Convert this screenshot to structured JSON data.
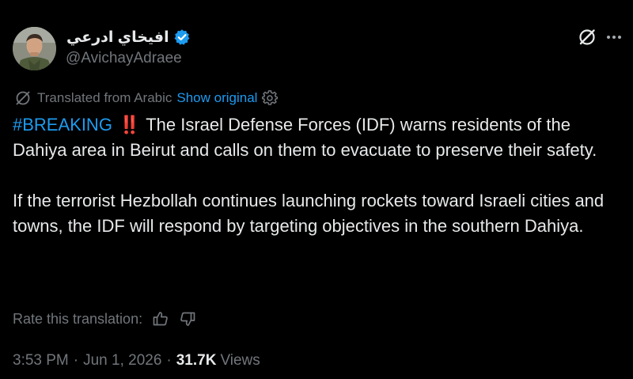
{
  "author": {
    "display_name": "افيخاي ادرعي",
    "handle": "@AvichayAdraee",
    "verified": true,
    "verified_color": "#1d9bf0",
    "avatar_icon": "avatar-soldier-portrait"
  },
  "header_actions": {
    "grok_icon": "grok-slash-icon",
    "more_icon": "more-horizontal-icon"
  },
  "translation": {
    "label": "Translated from Arabic",
    "show_original": "Show original",
    "icon": "translate-slash-icon",
    "settings_icon": "gear-icon"
  },
  "tweet": {
    "hashtag": "#BREAKING",
    "alert_emoji": "‼️",
    "paragraph1": "The Israel Defense Forces (IDF) warns residents of the Dahiya area in Beirut and calls on them to evacuate to preserve their safety.",
    "paragraph2": "If the terrorist Hezbollah continues launching rockets toward Israeli cities and towns, the IDF will respond by targeting objectives in the southern Dahiya."
  },
  "rate": {
    "label": "Rate this translation:",
    "up_icon": "thumbs-up-icon",
    "down_icon": "thumbs-down-icon"
  },
  "meta": {
    "time": "3:53 PM",
    "separator": "·",
    "date": "Jun 1, 2026",
    "views_count": "31.7K",
    "views_label": "Views"
  },
  "colors": {
    "background": "#000000",
    "text": "#e7e9ea",
    "muted": "#71767b",
    "accent": "#1d9bf0",
    "alert": "#e0245e"
  }
}
